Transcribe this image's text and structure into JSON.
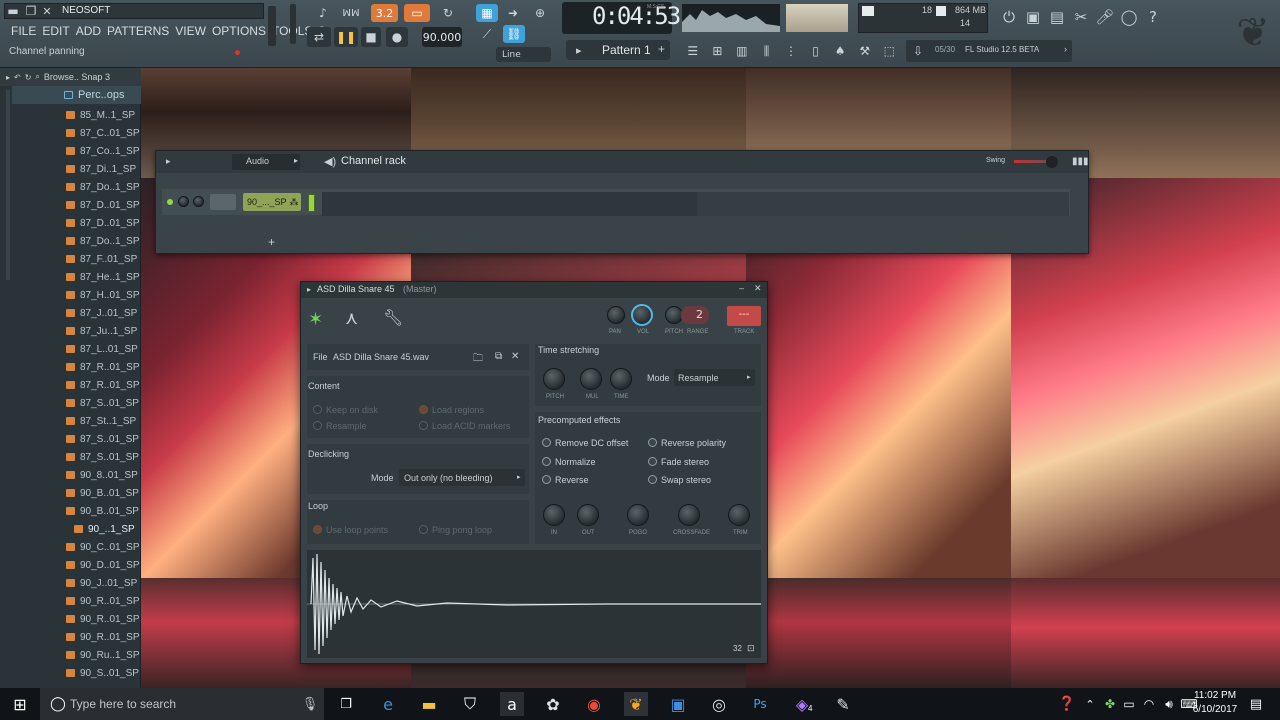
{
  "app": {
    "user": "NEOSOFT",
    "hint": "Channel panning",
    "time": "0:04:53",
    "time_unit": "M:S:CS",
    "tempo": "90.000",
    "snap_mode": "Line",
    "pattern": "Pattern 1",
    "cpu": "18",
    "mem": "864 MB",
    "poly": "14",
    "news": "05/30",
    "news_text": "FL Studio 12.5 BETA",
    "rec_count": "3.2"
  },
  "menu": [
    "FILE",
    "EDIT",
    "ADD",
    "PATTERNS",
    "VIEW",
    "OPTIONS",
    "TOOLS",
    "?"
  ],
  "browser": {
    "header": "Browse.. Snap 3",
    "folder": "Perc..ops",
    "files": [
      "85_M..1_SP",
      "87_C..01_SP",
      "87_Co..1_SP",
      "87_Di..1_SP",
      "87_Do..1_SP",
      "87_D..01_SP",
      "87_D..01_SP",
      "87_Do..1_SP",
      "87_F..01_SP",
      "87_He..1_SP",
      "87_H..01_SP",
      "87_J..01_SP",
      "87_Ju..1_SP",
      "87_L..01_SP",
      "87_R..01_SP",
      "87_R..01_SP",
      "87_S..01_SP",
      "87_St..1_SP",
      "87_S..01_SP",
      "87_S..01_SP",
      "90_8..01_SP",
      "90_B..01_SP",
      "90_B..01_SP",
      "90_..1_SP",
      "90_C..01_SP",
      "90_D..01_SP",
      "90_J..01_SP",
      "90_R..01_SP",
      "90_R..01_SP",
      "90_R..01_SP",
      "90_Ru..1_SP",
      "90_S..01_SP"
    ],
    "selected_index": 23
  },
  "channel_rack": {
    "filter": "Audio",
    "title": "Channel rack",
    "swing_label": "Swing",
    "channel_name": "90_..._SP",
    "add": "+"
  },
  "sampler": {
    "title": "ASD Dilla Snare 45",
    "title_suffix": "(Master)",
    "knob_labels": {
      "pan": "PAN",
      "vol": "VOL",
      "pitch": "PITCH",
      "range": "RANGE",
      "track": "TRACK"
    },
    "range_value": "2",
    "track_value": "---",
    "file_label": "File",
    "file_name": "ASD Dilla Snare 45.wav",
    "content_label": "Content",
    "keep_on_disk": "Keep on disk",
    "load_regions": "Load regions",
    "resample": "Resample",
    "load_acid": "Load ACID markers",
    "declicking_label": "Declicking",
    "mode_label": "Mode",
    "declick_mode": "Out only (no bleeding)",
    "loop_label": "Loop",
    "use_loop": "Use loop points",
    "ping_pong": "Ping pong loop",
    "ts_label": "Time stretching",
    "ts_knobs": [
      "PITCH",
      "MUL",
      "TIME"
    ],
    "ts_mode_label": "Mode",
    "ts_mode": "Resample",
    "pre_label": "Precomputed effects",
    "effects_left": [
      "Remove DC offset",
      "Normalize",
      "Reverse"
    ],
    "effects_right": [
      "Reverse polarity",
      "Fade stereo",
      "Swap stereo"
    ],
    "fx_knobs": [
      "IN",
      "OUT",
      "POGO",
      "CROSSFADE",
      "TRIM"
    ],
    "zoom": "32"
  },
  "taskbar": {
    "search": "Type here to search",
    "clock_time": "11:02 PM",
    "clock_date": "6/10/2017",
    "badge": "4"
  }
}
